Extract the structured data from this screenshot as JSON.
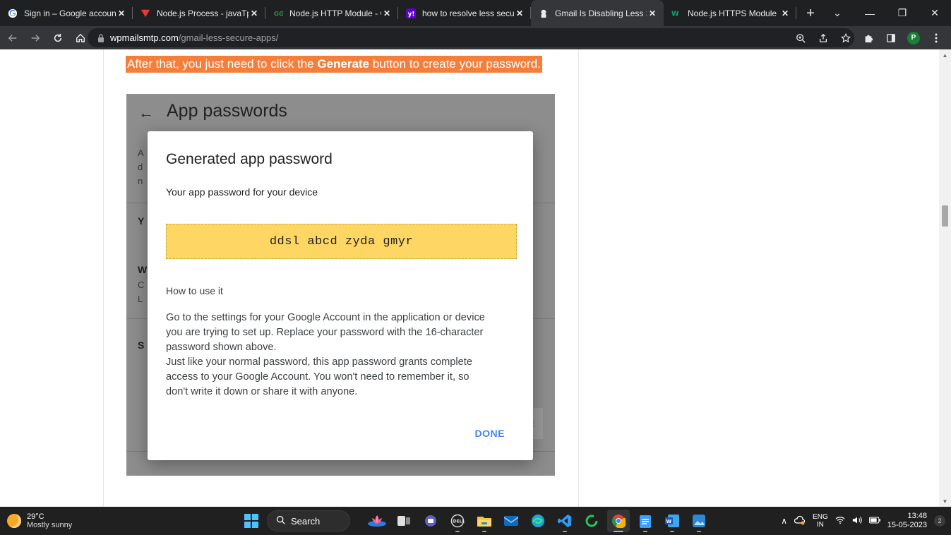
{
  "browser": {
    "tabs": [
      {
        "title": "Sign in – Google accounts",
        "icon": "google-g-icon",
        "active": false
      },
      {
        "title": "Node.js Process - javaTpoint",
        "icon": "javatpoint-icon",
        "active": false
      },
      {
        "title": "Node.js HTTP Module - GeeksforGeeks",
        "icon": "geeksforgeeks-icon",
        "active": false
      },
      {
        "title": "how to resolve less secure app",
        "icon": "yahoo-icon",
        "active": false
      },
      {
        "title": "Gmail Is Disabling Less Secure Apps",
        "icon": "wpmailsmtp-icon",
        "active": true
      },
      {
        "title": "Node.js HTTPS Module",
        "icon": "w3schools-icon",
        "active": false
      }
    ],
    "url_host": "wpmailsmtp.com",
    "url_path": "/gmail-less-secure-apps/",
    "profile_initial": "P"
  },
  "article": {
    "highlight_prefix": "After that, you just need to click the ",
    "highlight_bold": "Generate",
    "highlight_suffix": " button to create your password.",
    "screenshot": {
      "heading": "App passwords",
      "back_glyph": "←",
      "peek_a": "A",
      "peek_d": "d",
      "peek_n": "n",
      "peek_y": "Y",
      "peek_w": "W",
      "peek_c": "C",
      "peek_l": "L",
      "peek_s": "S"
    },
    "modal": {
      "title": "Generated app password",
      "subtitle": "Your app password for your device",
      "password": "ddsl abcd zyda gmyr",
      "howto_heading": "How to use it",
      "desc_line1": "Go to the settings for your Google Account in the application or device",
      "desc_line2": "you are trying to set up. Replace your password with the 16-character",
      "desc_line3": "password shown above.",
      "desc_line4": "Just like your normal password, this app password grants complete",
      "desc_line5": "access to your Google Account. You won't need to remember it, so",
      "desc_line6": "don't write it down or share it with anyone.",
      "done_label": "DONE"
    }
  },
  "taskbar": {
    "temperature": "29°C",
    "condition": "Mostly sunny",
    "search_label": "Search",
    "lang_top": "ENG",
    "lang_bottom": "IN",
    "time": "13:48",
    "date": "15-05-2023",
    "notification_count": "2"
  },
  "colors": {
    "highlight": "#f47e3c",
    "password_box": "#fdd663",
    "done_blue": "#4285f4"
  }
}
